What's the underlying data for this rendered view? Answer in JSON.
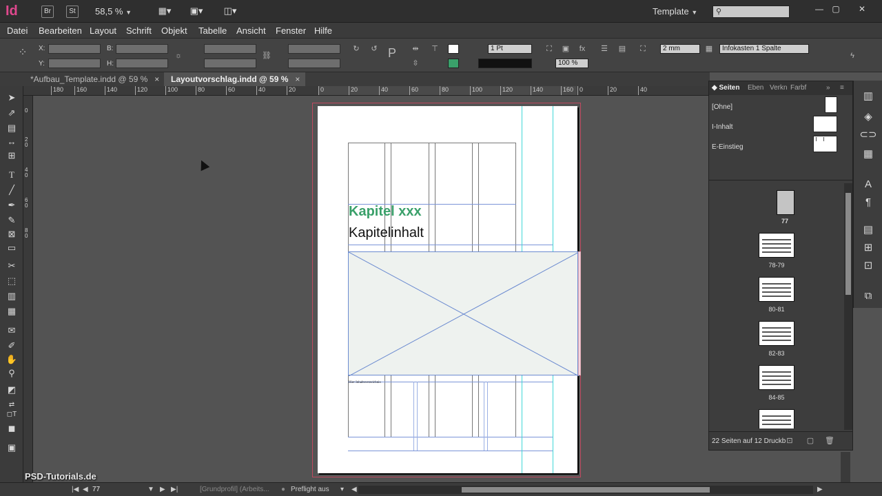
{
  "app": {
    "logo": "Id",
    "bridge_label": "Br",
    "stock_label": "St",
    "zoom": "58,5 %",
    "workspace": "Template"
  },
  "menu": [
    "Datei",
    "Bearbeiten",
    "Layout",
    "Schrift",
    "Objekt",
    "Tabelle",
    "Ansicht",
    "Fenster",
    "Hilfe"
  ],
  "control": {
    "x_label": "X:",
    "y_label": "Y:",
    "w_label": "B:",
    "h_label": "H:",
    "stroke_weight": "1 Pt",
    "opacity": "100 %",
    "offset": "2 mm",
    "object_style": "Infokasten 1 Spalte"
  },
  "tabs": [
    {
      "label": "*Aufbau_Template.indd @ 59 %",
      "close": "×"
    },
    {
      "label": "Layoutvorschlag.indd @ 59 %",
      "close": "×"
    }
  ],
  "ruler": {
    "h_ticks": [
      "180",
      "160",
      "140",
      "120",
      "100",
      "80",
      "60",
      "40",
      "20",
      "0",
      "20",
      "40",
      "60",
      "80",
      "100",
      "120",
      "140",
      "160",
      "0",
      "20",
      "40"
    ]
  },
  "document": {
    "heading": "Kapitel xxx",
    "subheading": "Kapitelinhalt",
    "small_text": "Hier Inhaltsverzeichnis"
  },
  "pages_panel": {
    "tabs": [
      "Seiten",
      "Eben",
      "Verkn",
      "Farbf"
    ],
    "masters": [
      "[Ohne]",
      "I-Inhalt",
      "E-Einstieg"
    ],
    "spreads": [
      "77",
      "78-79",
      "80-81",
      "82-83",
      "84-85"
    ],
    "footer": "22 Seiten auf 12 Druckb"
  },
  "status": {
    "page_number": "77",
    "profile": "[Grundprofil] (Arbeits...",
    "preflight": "Preflight aus"
  },
  "watermark": "PSD-Tutorials.de",
  "colors": {
    "accent": "#3aa06a",
    "bleed": "#c04a60",
    "guide": "#3fd7d7"
  }
}
